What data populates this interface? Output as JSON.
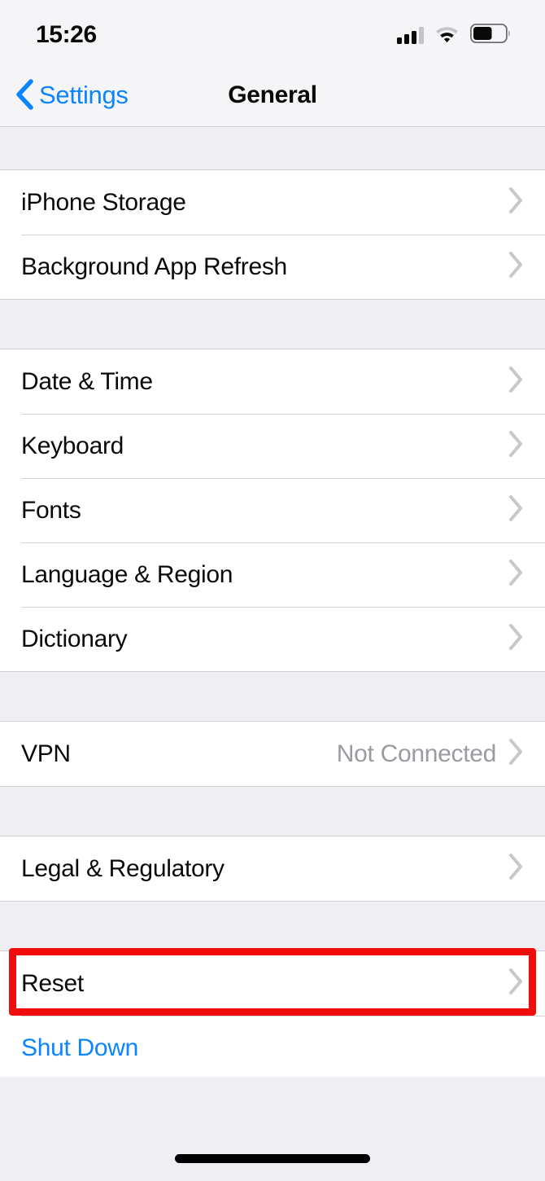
{
  "status_bar": {
    "time": "15:26",
    "cellular_icon": "cellular-signal-icon",
    "cellular_bars_filled": 3,
    "cellular_bars_total": 4,
    "wifi_icon": "wifi-icon",
    "battery_icon": "battery-icon",
    "battery_level_percent": 55
  },
  "nav": {
    "back_icon": "chevron-left-icon",
    "back_label": "Settings",
    "title": "General"
  },
  "colors": {
    "accent_blue": "#0a84ff",
    "annotation_red": "#f20d0d",
    "value_gray": "#9a9aa0",
    "chevron_gray": "#c7c7cc",
    "group_background": "#ffffff",
    "page_background": "#eeeef3"
  },
  "groups": [
    {
      "rows": [
        {
          "label": "iPhone Storage",
          "value": "",
          "accessory": "chevron-right-icon",
          "style": "default",
          "name": "row-iphone-storage"
        },
        {
          "label": "Background App Refresh",
          "value": "",
          "accessory": "chevron-right-icon",
          "style": "default",
          "name": "row-background-app-refresh"
        }
      ]
    },
    {
      "rows": [
        {
          "label": "Date & Time",
          "value": "",
          "accessory": "chevron-right-icon",
          "style": "default",
          "name": "row-date-and-time"
        },
        {
          "label": "Keyboard",
          "value": "",
          "accessory": "chevron-right-icon",
          "style": "default",
          "name": "row-keyboard"
        },
        {
          "label": "Fonts",
          "value": "",
          "accessory": "chevron-right-icon",
          "style": "default",
          "name": "row-fonts"
        },
        {
          "label": "Language & Region",
          "value": "",
          "accessory": "chevron-right-icon",
          "style": "default",
          "name": "row-language-and-region"
        },
        {
          "label": "Dictionary",
          "value": "",
          "accessory": "chevron-right-icon",
          "style": "default",
          "name": "row-dictionary"
        }
      ]
    },
    {
      "rows": [
        {
          "label": "VPN",
          "value": "Not Connected",
          "accessory": "chevron-right-icon",
          "style": "default",
          "name": "row-vpn"
        }
      ]
    },
    {
      "rows": [
        {
          "label": "Legal & Regulatory",
          "value": "",
          "accessory": "chevron-right-icon",
          "style": "default",
          "name": "row-legal-and-regulatory"
        }
      ]
    },
    {
      "highlighted": true,
      "rows": [
        {
          "label": "Reset",
          "value": "",
          "accessory": "chevron-right-icon",
          "style": "default",
          "name": "row-reset"
        },
        {
          "label": "Shut Down",
          "value": "",
          "accessory": "none",
          "style": "link",
          "name": "row-shut-down"
        }
      ]
    }
  ],
  "home_indicator": "home-indicator"
}
